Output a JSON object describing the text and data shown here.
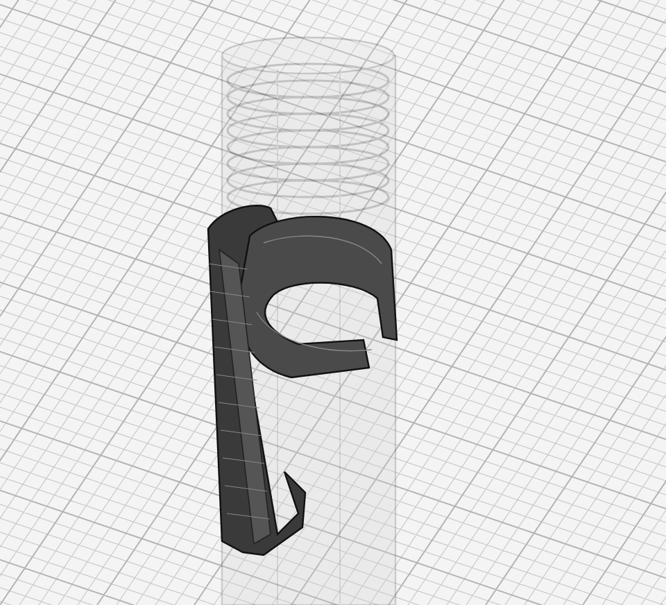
{
  "viewport": {
    "grid_visible": true,
    "bodies": [
      {
        "kind": "cylinder",
        "transparent": true
      },
      {
        "kind": "clip",
        "transparent": false
      }
    ]
  }
}
